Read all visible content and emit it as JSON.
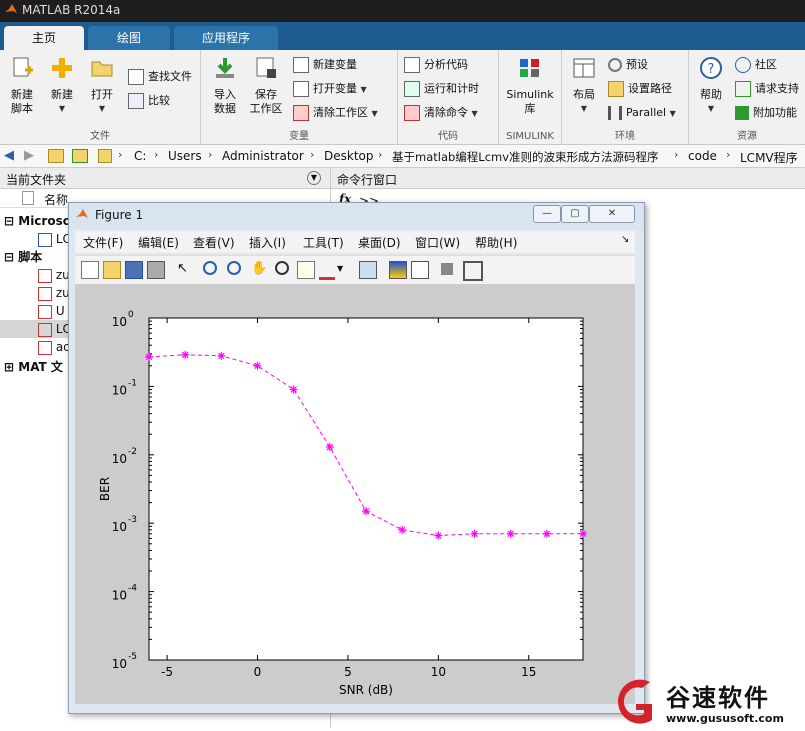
{
  "app": {
    "title": "MATLAB R2014a"
  },
  "tabs": [
    {
      "label": "主页",
      "active": true
    },
    {
      "label": "绘图",
      "active": false
    },
    {
      "label": "应用程序",
      "active": false
    }
  ],
  "ribbon": {
    "file": {
      "group_label": "文件",
      "new_script": "新建\n脚本",
      "new": "新建",
      "open": "打开",
      "find_files": "查找文件",
      "compare": "比较"
    },
    "variable": {
      "group_label": "变量",
      "import": "导入\n数据",
      "save_workspace": "保存\n工作区",
      "new_variable": "新建变量",
      "open_variable": "打开变量",
      "clear_workspace": "清除工作区"
    },
    "code": {
      "group_label": "代码",
      "analyze": "分析代码",
      "run_time": "运行和计时",
      "clear_commands": "清除命令"
    },
    "simulink": {
      "group_label": "SIMULINK",
      "library": "Simulink\n库"
    },
    "environment": {
      "group_label": "环境",
      "layout": "布局",
      "preferences": "预设",
      "set_path": "设置路径",
      "parallel": "Parallel"
    },
    "resources": {
      "group_label": "资源",
      "help": "帮助",
      "community": "社区",
      "request_support": "请求支持",
      "addons": "附加功能"
    }
  },
  "address": {
    "crumbs": [
      "C:",
      "Users",
      "Administrator",
      "Desktop",
      "基于matlab编程Lcmv准则的波束形成方法源码程序",
      "code",
      "LCMV程序"
    ]
  },
  "left_panel": {
    "title": "当前文件夹",
    "column": "名称",
    "groups": [
      {
        "label": "Microso",
        "items": [
          "LC"
        ]
      },
      {
        "label": "脚本",
        "items": [
          "zu",
          "zu",
          "U",
          "LC",
          "ac"
        ]
      },
      {
        "label": "MAT 文",
        "items": []
      }
    ],
    "selected_item": "LC"
  },
  "command_window": {
    "title": "命令行窗口",
    "prompt_icon": "fx",
    "prompt": ">>"
  },
  "figure": {
    "title": "Figure 1",
    "menu": [
      "文件(F)",
      "编辑(E)",
      "查看(V)",
      "插入(I)",
      "工具(T)",
      "桌面(D)",
      "窗口(W)",
      "帮助(H)"
    ]
  },
  "chart_data": {
    "type": "line",
    "title": "",
    "xlabel": "SNR (dB)",
    "ylabel": "BER",
    "yscale": "log",
    "xlim": [
      -6,
      18
    ],
    "ylim": [
      1e-05,
      1
    ],
    "xticks": [
      -5,
      0,
      5,
      10,
      15
    ],
    "yticks": [
      1e-05,
      0.0001,
      0.001,
      0.01,
      0.1,
      1
    ],
    "ytick_labels": [
      {
        "base": "10",
        "exp": "-5"
      },
      {
        "base": "10",
        "exp": "-4"
      },
      {
        "base": "10",
        "exp": "-3"
      },
      {
        "base": "10",
        "exp": "-2"
      },
      {
        "base": "10",
        "exp": "-1"
      },
      {
        "base": "10",
        "exp": "0"
      }
    ],
    "grid": false,
    "series": [
      {
        "x": [
          -6,
          -4,
          -2,
          0,
          2,
          4,
          6,
          8,
          10,
          12,
          14,
          16,
          18
        ],
        "y": [
          0.27,
          0.29,
          0.28,
          0.2,
          0.09,
          0.013,
          0.0015,
          0.0008,
          0.00066,
          0.0007,
          0.0007,
          0.0007,
          0.0007
        ],
        "color": "#ff00ff",
        "line_style": "dashed",
        "marker": "*"
      }
    ]
  },
  "watermark": {
    "text": "谷速软件",
    "url": "www.gususoft.com"
  }
}
